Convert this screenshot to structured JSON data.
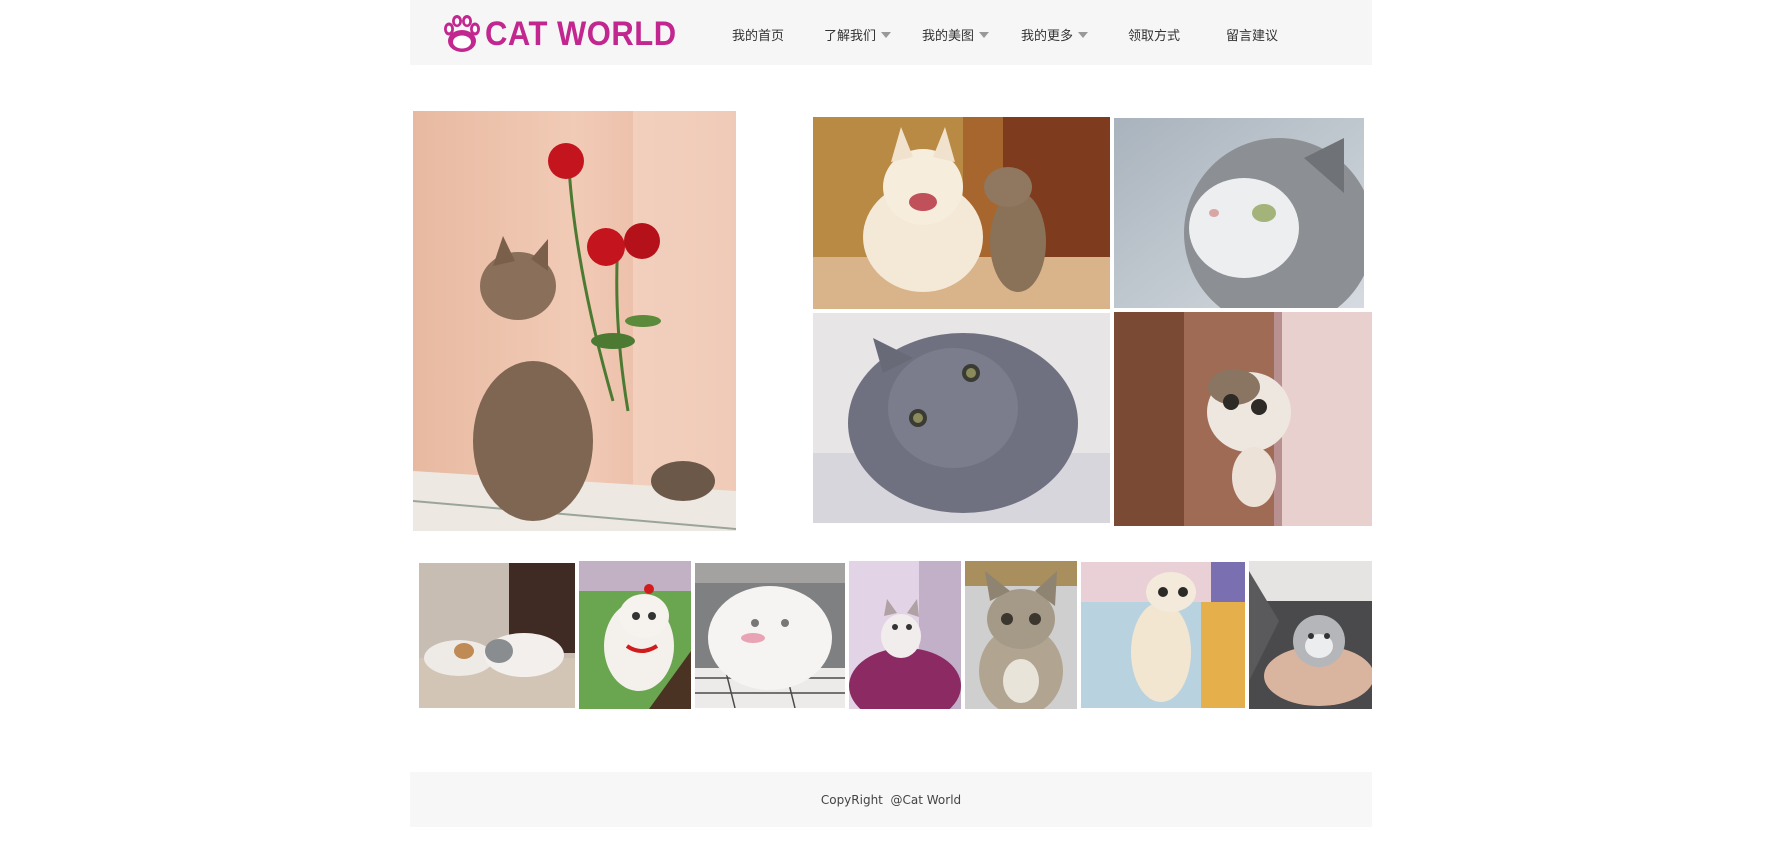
{
  "brand": {
    "name": "CAT WORLD",
    "logo_icon": "paw-icon",
    "color": "#c2278f"
  },
  "nav": [
    {
      "label": "我的首页",
      "dropdown": false
    },
    {
      "label": "了解我们",
      "dropdown": true
    },
    {
      "label": "我的美图",
      "dropdown": true
    },
    {
      "label": "我的更多",
      "dropdown": true
    },
    {
      "label": "领取方式",
      "dropdown": false
    },
    {
      "label": "留言建议",
      "dropdown": false
    }
  ],
  "gallery": {
    "featured": "cat-with-red-roses-photo",
    "grid": [
      "smiling-dog-and-cat-photo",
      "grey-white-cat-profile-photo",
      "grey-kitten-lying-photo",
      "kitten-peeking-behind-door-photo"
    ],
    "strip": [
      "two-kittens-lying-photo",
      "white-kitten-red-collar-photo",
      "white-fluffy-cat-photo",
      "kitten-on-purple-cushion-photo",
      "tabby-kitten-sitting-photo",
      "cream-kitten-standing-photo",
      "kitten-in-hand-photo"
    ]
  },
  "footer": {
    "copyright": "CopyRight  @Cat World"
  }
}
